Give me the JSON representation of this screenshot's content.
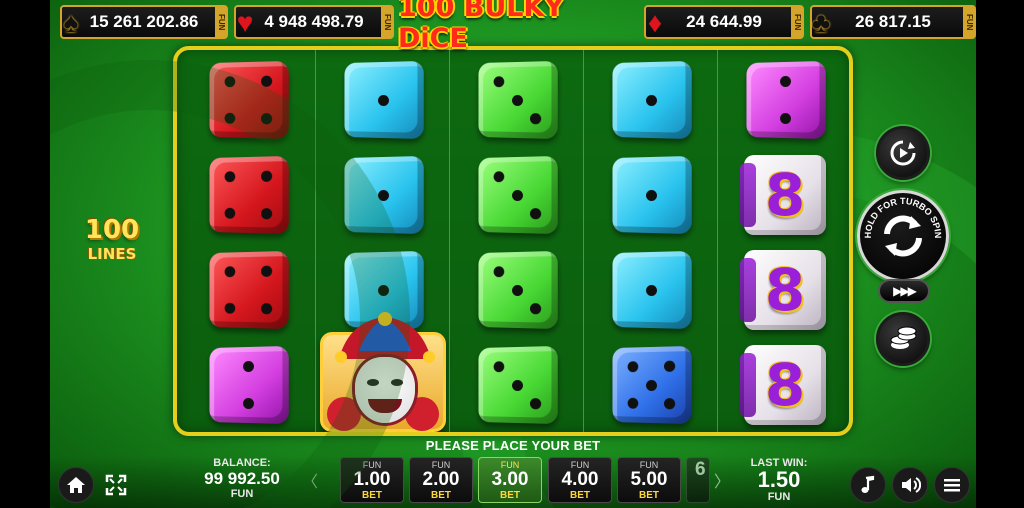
{
  "jackpots": [
    {
      "suit": "spade",
      "glyph": "♠",
      "value": "15 261 202.86",
      "currency": "FUN"
    },
    {
      "suit": "heart",
      "glyph": "♥",
      "value": "4 948 498.79",
      "currency": "FUN"
    },
    {
      "suit": "diamond",
      "glyph": "♦",
      "value": "24 644.99",
      "currency": "FUN"
    },
    {
      "suit": "club",
      "glyph": "♣",
      "value": "26 817.15",
      "currency": "FUN"
    }
  ],
  "logo": "100 BULKY DiCE",
  "lines": {
    "count": "100",
    "label": "LINES"
  },
  "reels": [
    [
      "red-4",
      "red-4",
      "red-4",
      "magenta-2"
    ],
    [
      "cyan-1",
      "cyan-1",
      "cyan-1",
      "joker"
    ],
    [
      "green-3",
      "green-3",
      "green-3",
      "green-3"
    ],
    [
      "cyan-1",
      "cyan-1",
      "cyan-1",
      "blue-5"
    ],
    [
      "magenta-2",
      "eight",
      "eight",
      "eight"
    ]
  ],
  "reel_symbols": {
    "eight_label": "8"
  },
  "controls": {
    "spin_hint": "HOLD FOR TURBO SPIN",
    "turbo_label": "▶▶▶",
    "autoplay_icon": "autoplay-icon",
    "spin_icon": "spin-arrows-icon",
    "bet_icon": "coins-icon"
  },
  "message": "PLEASE PLACE YOUR BET",
  "balance": {
    "label": "BALANCE:",
    "value": "99 992.50",
    "currency": "FUN"
  },
  "last_win": {
    "label": "LAST WIN:",
    "value": "1.50",
    "currency": "FUN"
  },
  "bets": [
    {
      "top": "FUN",
      "value": "1.00",
      "bottom": "BET",
      "active": false
    },
    {
      "top": "FUN",
      "value": "2.00",
      "bottom": "BET",
      "active": false
    },
    {
      "top": "FUN",
      "value": "3.00",
      "bottom": "BET",
      "active": true
    },
    {
      "top": "FUN",
      "value": "4.00",
      "bottom": "BET",
      "active": false
    },
    {
      "top": "FUN",
      "value": "5.00",
      "bottom": "BET",
      "active": false
    },
    {
      "top": "",
      "value": "6",
      "bottom": "",
      "active": false
    }
  ],
  "nav": {
    "left_arrow": "〈",
    "right_arrow": "〉"
  },
  "colors": {
    "frame": "#e6cf1c",
    "felt": "#1f9a23",
    "active_bet": "#3c8a2a",
    "bet_label": "#ffd93a"
  }
}
